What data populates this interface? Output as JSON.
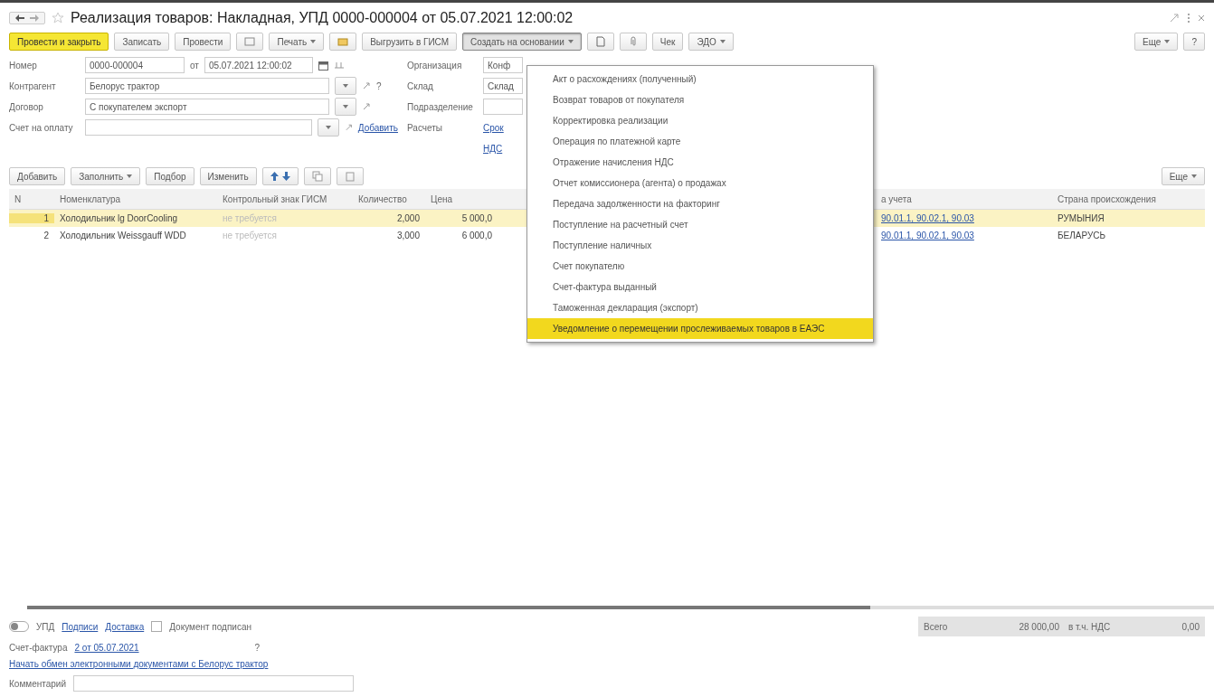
{
  "window": {
    "title": "Реализация товаров: Накладная, УПД 0000-000004 от 05.07.2021 12:00:02"
  },
  "toolbar": {
    "buttons": [
      {
        "kind": "primary",
        "label": "Провести и закрыть"
      },
      {
        "kind": "plain",
        "label": "Записать"
      },
      {
        "kind": "plain",
        "label": "Провести"
      },
      {
        "kind": "icon"
      },
      {
        "kind": "dropdown",
        "label": "Печать",
        "open": false
      },
      {
        "kind": "icon"
      },
      {
        "kind": "plain",
        "label": "Выгрузить в ГИСМ"
      },
      {
        "kind": "dropdown",
        "label": "Создать на основании",
        "open": true
      },
      {
        "kind": "icon"
      },
      {
        "kind": "icon"
      },
      {
        "kind": "plain",
        "label": "Чек"
      },
      {
        "kind": "dropdown",
        "label": "ЭДО",
        "open": false
      }
    ],
    "right": [
      {
        "kind": "dropdown",
        "label": "Еще",
        "open": false
      },
      {
        "kind": "plain",
        "label": "?"
      }
    ]
  },
  "form": {
    "number_label": "Номер",
    "number": "0000-000004",
    "date_label": "от",
    "date": "05.07.2021 12:00:02",
    "left": [
      {
        "label": "Контрагент",
        "value": "Белорус трактор",
        "extra": "?"
      },
      {
        "label": "Договор",
        "value": "С покупателем экспорт"
      },
      {
        "label": "Счет на оплату",
        "link": "Добавить"
      }
    ],
    "right": [
      {
        "label": "Организация",
        "value": "Конф"
      },
      {
        "label": "Склад",
        "value": "Склад"
      },
      {
        "label": "Подразделение"
      },
      {
        "label": "Расчеты",
        "link": "Срок"
      }
    ],
    "vat_link": "НДС"
  },
  "create_menu": {
    "items": [
      {
        "label": "Акт о расхождениях (полученный)",
        "selected": false
      },
      {
        "label": "Возврат товаров от покупателя",
        "selected": false
      },
      {
        "label": "Корректировка реализации",
        "selected": false
      },
      {
        "label": "Операция по платежной карте",
        "selected": false
      },
      {
        "label": "Отражение начисления НДС",
        "selected": false
      },
      {
        "label": "Отчет комиссионера (агента) о продажах",
        "selected": false
      },
      {
        "label": "Передача задолженности на факторинг",
        "selected": false
      },
      {
        "label": "Поступление на расчетный счет",
        "selected": false
      },
      {
        "label": "Поступление наличных",
        "selected": false
      },
      {
        "label": "Счет покупателю",
        "selected": false
      },
      {
        "label": "Счет-фактура выданный",
        "selected": false
      },
      {
        "label": "Таможенная декларация (экспорт)",
        "selected": false
      },
      {
        "label": "Уведомление о перемещении прослеживаемых товаров в ЕАЭС",
        "selected": true
      }
    ]
  },
  "table_toolbar": {
    "buttons": [
      {
        "kind": "plain",
        "label": "Добавить"
      },
      {
        "kind": "dropdown",
        "label": "Заполнить"
      },
      {
        "kind": "plain",
        "label": "Подбор"
      },
      {
        "kind": "plain",
        "label": "Изменить"
      },
      {
        "kind": "arrows"
      },
      {
        "kind": "icon"
      },
      {
        "kind": "icon"
      }
    ],
    "more": "Еще"
  },
  "table": {
    "columns": [
      "N",
      "Номенклатура",
      "Контрольный знак ГИСМ",
      "Количество",
      "Цена",
      "а учета",
      "Страна происхождения"
    ],
    "rows": [
      {
        "n": "1",
        "item": "Холодильник lg DoorCooling",
        "gism": "не требуется",
        "qty": "2,000",
        "price": "5 000,0",
        "accounts": "90.01.1, 90.02.1, 90.03",
        "country": "РУМЫНИЯ",
        "selected": true
      },
      {
        "n": "2",
        "item": "Холодильник Weissgauff WDD",
        "gism": "не требуется",
        "qty": "3,000",
        "price": "6 000,0",
        "accounts": "90.01.1, 90.02.1, 90.03",
        "country": "БЕЛАРУСЬ",
        "selected": false
      }
    ]
  },
  "footer": {
    "upd": {
      "label": "УПД",
      "on": false
    },
    "links": [
      "Подписи",
      "Доставка"
    ],
    "signed": {
      "label": "Документ подписан",
      "checked": false
    },
    "total_label": "Всего",
    "total": "28 000,00",
    "vat_label": "в т.ч. НДС",
    "vat": "0,00",
    "invoice_label": "Счет-фактура",
    "invoice": "2 от 05.07.2021",
    "invoice_help": "?",
    "exchange_link": "Начать обмен электронными документами с Белорус трактор",
    "comment_label": "Комментарий"
  }
}
